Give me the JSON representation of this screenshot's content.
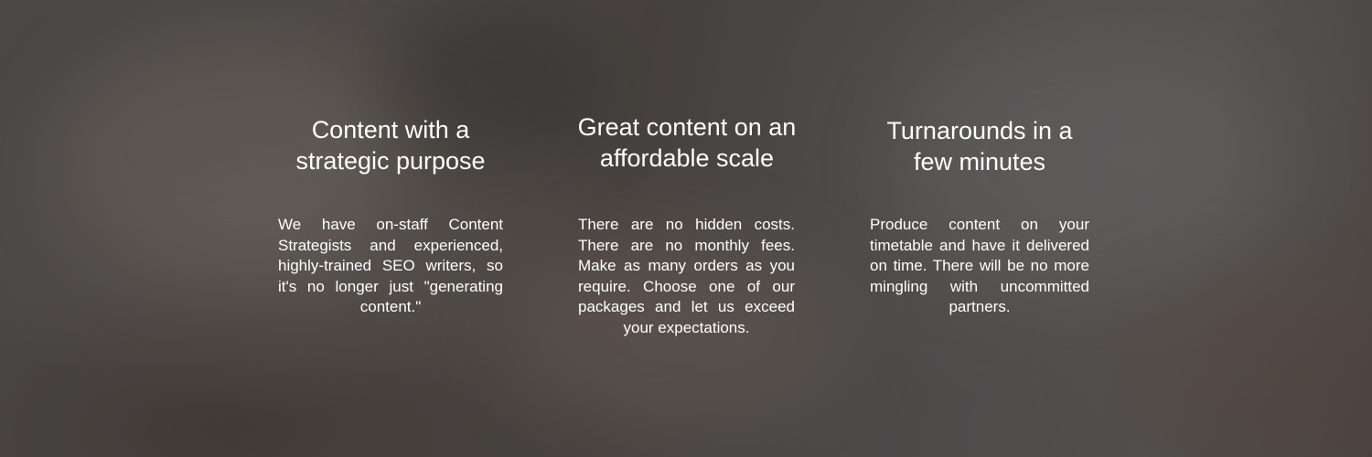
{
  "features": [
    {
      "title": "Content with a strategic purpose",
      "text": "We have on-staff Content Strategists and experienced, highly-trained SEO writers, so it's no longer just \"generating content.\""
    },
    {
      "title": "Great content on an affordable scale",
      "text": "There are no hidden costs. There are no monthly fees. Make as many orders as you require. Choose one of our packages and let us exceed your expectations."
    },
    {
      "title": "Turnarounds in a few minutes",
      "text": "Produce content on your timetable and have it delivered on time. There will be no more mingling with uncommitted partners."
    }
  ]
}
